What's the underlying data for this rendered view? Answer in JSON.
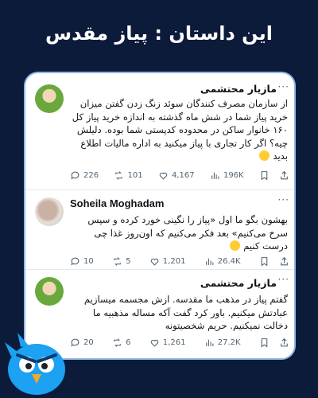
{
  "page": {
    "title": "این داستان : پیاز مقدس"
  },
  "tweets": [
    {
      "author": "مازیار محتشمی",
      "text": "از سازمان مصرف کنندگان سوئد زنگ زدن گفتن میزان خرید پیاز شما در شش ماه گذشته به اندازه خرید پیاز کل ۱۶۰ خانوار ساکن در محدوده کدپستی شما بوده. دلیلش چیه؟ اگر کار تجاری با پیاز میکنید به اداره مالیات اطلاع بدید",
      "replies": "226",
      "retweets": "101",
      "likes": "4,167",
      "views": "196K"
    },
    {
      "author": "Soheila Moghadam",
      "text": "بهشون بگو ما اول «پیاز را نگینی خورد کرده و سپس سرخ می‌کنیم» بعد فکر می‌کنیم که اون‌روز غذا چی درست کنیم",
      "replies": "10",
      "retweets": "5",
      "likes": "1,201",
      "views": "26.4K"
    },
    {
      "author": "مازیار محتشمی",
      "text": "گفتم پیاز در مذهب ما مقدسه. ازش مجسمه میسازیم عبادتش میکنیم. باور کرد گفت آکه مساله مذهبیه ما دخالت نمیکنیم. حریم شخصیتونه",
      "replies": "20",
      "retweets": "6",
      "likes": "1,261",
      "views": "27.2K"
    }
  ],
  "icons": {
    "reply": "reply-icon",
    "retweet": "retweet-icon",
    "like": "heart-icon",
    "views": "views-icon",
    "bookmark": "bookmark-icon",
    "share": "share-icon"
  },
  "colors": {
    "background": "#0d1b3a",
    "card": "#ffffff",
    "card_border": "#8fb8e8",
    "muted": "#536471"
  }
}
